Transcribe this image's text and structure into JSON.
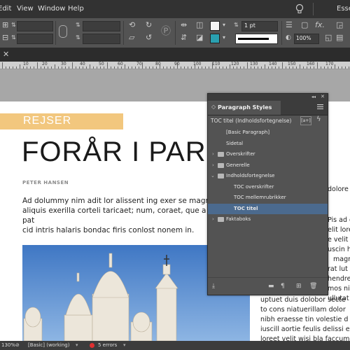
{
  "menu": {
    "items": [
      "Edit",
      "View",
      "Window",
      "Help"
    ],
    "workspace": "Essen"
  },
  "control_bar": {
    "stroke_weight": "1 pt",
    "zoom": "100%"
  },
  "ruler": {
    "labels": [
      "10",
      "20",
      "30",
      "40",
      "50",
      "60",
      "70",
      "80",
      "90",
      "100",
      "110",
      "120",
      "130",
      "140",
      "150",
      "160",
      "170"
    ]
  },
  "document": {
    "tag": "REJSER",
    "title": "FORÅR I PARIS",
    "byline": "PETER HANSEN",
    "body": "Ad dolummy nim adit lor alissent ing exer se magr\naliquis exerilla corteli taricaet; num, coraet, que a pat\ncid intris halaris bondac firis conlost nonem in.",
    "right_column": [
      "dolore",
      "Pis ad d",
      "elit lore",
      "e velit l",
      "uscin he",
      "magn",
      "rat lut",
      "hendrer",
      "mos nim",
      "ullutat u",
      "uptuet duis dolobor secte",
      "to cons niatuerillam dolor",
      "nibh eraesse tin volestie d",
      "iuscill aortie feulis delissi ex",
      "loreet velit wisi bla faccum"
    ]
  },
  "panel": {
    "title": "Paragraph Styles",
    "current_style": "TOC titel (Indholdsfortegnelse)",
    "new_from_label": "[a+]",
    "rows": [
      {
        "label": "[Basic Paragraph]",
        "type": "style",
        "level": 0
      },
      {
        "label": "Sidetal",
        "type": "style",
        "level": 0
      },
      {
        "label": "Overskrifter",
        "type": "group",
        "level": 0,
        "expanded": false
      },
      {
        "label": "Generelle",
        "type": "group",
        "level": 0,
        "expanded": false
      },
      {
        "label": "Indholdsfortegnelse",
        "type": "group",
        "level": 0,
        "expanded": true
      },
      {
        "label": "TOC overskrifter",
        "type": "style",
        "level": 1
      },
      {
        "label": "TOC mellemrubrikker",
        "type": "style",
        "level": 1
      },
      {
        "label": "TOC titel",
        "type": "style",
        "level": 1,
        "selected": true
      },
      {
        "label": "Faktaboks",
        "type": "group",
        "level": 0,
        "expanded": false
      }
    ]
  },
  "status": {
    "zoom": "130%",
    "page_style": "[Basic] (working)",
    "errors": "5 errors"
  },
  "colors": {
    "accent_bar": "#f2c77e",
    "selection": "#4b6a8e",
    "error": "#e03030"
  }
}
